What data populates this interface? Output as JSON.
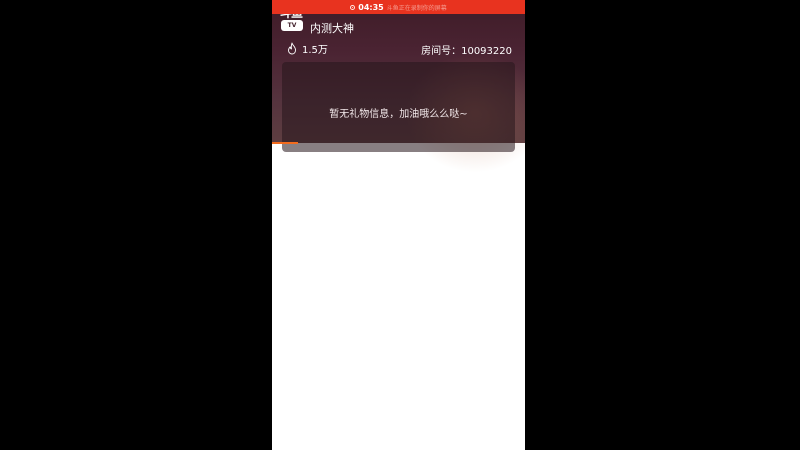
{
  "status_bar": {
    "time": "04:35",
    "text": "斗鱼正在录制你的屏幕"
  },
  "logo": {
    "cn": "斗鱼",
    "en": "TV"
  },
  "room": {
    "streamer_name": "内测大神",
    "heat": "1.5万",
    "room_id_label": "房间号：10093220"
  },
  "gift_panel": {
    "empty_message": "暂无礼物信息，加油哦么么哒~"
  },
  "colors": {
    "status_bar": "#e8331f",
    "accent": "#f26b1d",
    "header_top": "#3e1c27",
    "header_bottom": "#5e3e41"
  },
  "icons": {
    "heat": "flame-icon",
    "recording": "record-dot-icon"
  }
}
